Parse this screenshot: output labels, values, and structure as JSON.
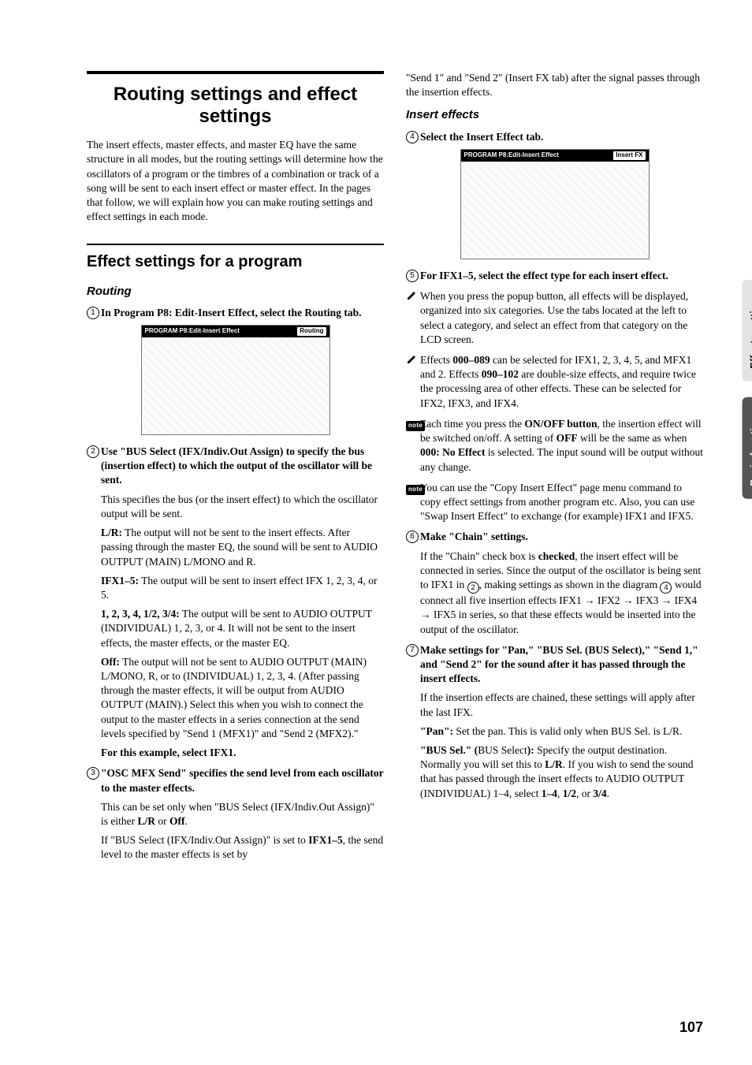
{
  "sideTabs": {
    "top": "Effects settings",
    "bottom": "Basic functions"
  },
  "pageNumber": "107",
  "title": "Routing settings and effect settings",
  "intro": "The insert effects, master effects, and master EQ have the same structure in all modes, but the routing settings will determine how the oscillators of a program or the timbres of a combination or track of a song will be sent to each insert effect or master effect. In the pages that follow, we will explain how you can make routing settings and effect settings in each mode.",
  "sectionA": "Effect settings for a program",
  "routingHeading": "Routing",
  "step1": "In Program P8: Edit-Insert Effect, select the Routing tab.",
  "fig1": {
    "title": "PROGRAM P8:Edit-Insert Effect",
    "tab": "Routing"
  },
  "step2": "Use \"BUS Select (IFX/Indiv.Out Assign) to specify the bus (insertion effect) to which the output of the oscillator will be sent.",
  "step2desc": "This specifies the bus (or the insert effect) to which the oscillator output will be sent.",
  "lr_label": "L/R:",
  "lr_text": " The output will not be sent to the insert effects. After passing through the master EQ, the sound will be sent to AUDIO OUTPUT (MAIN) L/MONO and R.",
  "ifx15_label": "IFX1–5:",
  "ifx15_text": " The output will be sent to insert effect IFX 1, 2, 3, 4, or 5.",
  "nums_label": "1, 2, 3, 4, 1/2, 3/4:",
  "nums_text": " The output will be sent to AUDIO OUTPUT (INDIVIDUAL) 1, 2, 3, or 4. It will not be sent to the insert effects, the master effects, or the master EQ.",
  "off_label": "Off:",
  "off_text": " The output will not be sent to AUDIO OUTPUT (MAIN) L/MONO, R, or to (INDIVIDUAL) 1, 2, 3, 4. (After passing through the master effects, it will be output from AUDIO OUTPUT (MAIN).) Select this when you wish to connect the output to the master effects in a series connection at the send levels specified by \"Send 1 (MFX1)\" and \"Send 2 (MFX2).\"",
  "example_line": "For this example, select IFX1.",
  "step3": "\"OSC MFX Send\" specifies the send level from each oscillator to the master effects.",
  "step3p1a": "This can be set only when \"BUS Select (IFX/Indiv.Out Assign)\" is either ",
  "step3p1b": " or ",
  "step3p1_lr": "L/R",
  "step3p1_off": "Off",
  "step3p1_end": ".",
  "step3p2a": "If \"BUS Select (IFX/Indiv.Out Assign)\" is set to ",
  "step3p2_ifx": "IFX1–5",
  "step3p2b": ", the send level to the master effects is set by ",
  "rightCont": "\"Send 1\" and \"Send 2\" (Insert FX tab) after the signal passes through the insertion effects.",
  "insertHeading": "Insert effects",
  "step4": "Select the Insert Effect tab.",
  "fig2": {
    "title": "PROGRAM P8:Edit-Insert Effect",
    "tab": "Insert FX"
  },
  "step5": "For IFX1–5, select the effect type for each insert effect.",
  "pencil1": "When you press the popup button, all effects will be displayed, organized into six categories. Use the tabs located at the left to select a category, and select an effect from that category on the LCD screen.",
  "pencil2a": "Effects ",
  "pencil2_000": "000–089",
  "pencil2b": " can be selected for IFX1, 2, 3, 4, 5, and MFX1 and 2. Effects ",
  "pencil2_090": "090–102",
  "pencil2c": " are double-size effects, and require twice the processing area of other effects. These can be selected for IFX2, IFX3, and IFX4.",
  "note1a": "Each time you press the ",
  "note1_onoff": "ON/OFF button",
  "note1b": ", the insertion effect will be switched on/off. A setting of ",
  "note1_off": "OFF",
  "note1c": " will be the same as when ",
  "note1_000": "000: No Effect",
  "note1d": " is selected. The input sound will be output without any change.",
  "note2": "You can use the \"Copy Insert Effect\" page menu command to copy effect settings from another program etc. Also, you can use \"Swap Insert Effect\" to exchange (for example) IFX1 and IFX5.",
  "step6": "Make \"Chain\" settings.",
  "step6p_a": "If the \"Chain\" check box is ",
  "step6p_checked": "checked",
  "step6p_b": ", the insert effect will be connected in series. Since the output of the oscillator is being sent to IFX1 in ",
  "step6p_c": ", making settings as shown in the diagram ",
  "step6p_d": " would connect all five insertion effects IFX1 → IFX2 → IFX3 → IFX4 → IFX5 in series, so that these effects would be inserted into the output of the oscillator.",
  "step7": "Make settings for \"Pan,\" \"BUS Sel. (BUS Select),\" \"Send 1,\" and \"Send 2\" for the sound after it has passed through the insert effects.",
  "step7p1": "If the insertion effects are chained, these settings will apply after the last IFX.",
  "step7_pan_label": "\"Pan\":",
  "step7_pan_text": " Set the pan. This is valid only when BUS Sel. is L/R.",
  "step7_bus_label": "\"BUS Sel.\" (",
  "step7_bus_mid": "BUS Select",
  "step7_bus_label2": "):",
  "step7_bus_text": " Specify the output destination. Normally you will set this to ",
  "step7_bus_lr": "L/R",
  "step7_bus_text2": ". If you wish to send the sound that has passed through the insert effects to AUDIO OUTPUT (INDIVIDUAL) 1–4, select ",
  "step7_bus_14": "1–4",
  "step7_bus_c1": ", ",
  "step7_bus_12": "1/2",
  "step7_bus_c2": ", or ",
  "step7_bus_34": "3/4",
  "step7_bus_end": "."
}
